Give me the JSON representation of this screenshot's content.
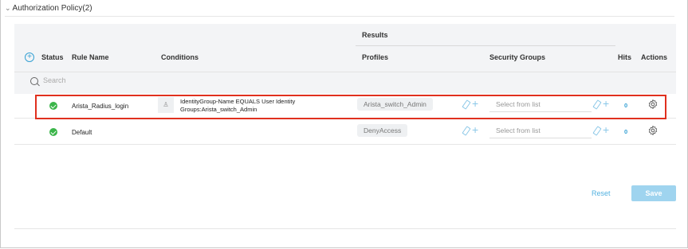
{
  "section": {
    "title": "Authorization Policy(2)"
  },
  "table": {
    "results_group": "Results",
    "columns": {
      "status": "Status",
      "rule_name": "Rule Name",
      "conditions": "Conditions",
      "profiles": "Profiles",
      "security_groups": "Security Groups",
      "hits": "Hits",
      "actions": "Actions"
    },
    "search_placeholder": "Search",
    "rows": [
      {
        "rule_name": "Arista_Radius_login",
        "condition": "IdentityGroup-Name EQUALS User Identity Groups:Arista_switch_Admin",
        "profile": "Arista_switch_Admin",
        "security_group_placeholder": "Select from list",
        "hits": "0",
        "highlighted": true
      },
      {
        "rule_name": "Default",
        "condition": "",
        "profile": "DenyAccess",
        "security_group_placeholder": "Select from list",
        "hits": "0",
        "highlighted": false
      }
    ]
  },
  "footer": {
    "reset_label": "Reset",
    "save_label": "Save"
  },
  "colors": {
    "accent": "#34a0d3",
    "highlight_border": "#e0301e",
    "status_ok": "#3bb54a",
    "save_disabled": "#9fd4ef"
  },
  "icons": {
    "expand": "chevron-down-icon",
    "add": "plus-circle-icon",
    "search": "search-icon",
    "status": "check-circle-icon",
    "condition": "user-group-icon",
    "edit": "pencil-icon",
    "add_item": "plus-icon",
    "actions": "gear-icon"
  }
}
